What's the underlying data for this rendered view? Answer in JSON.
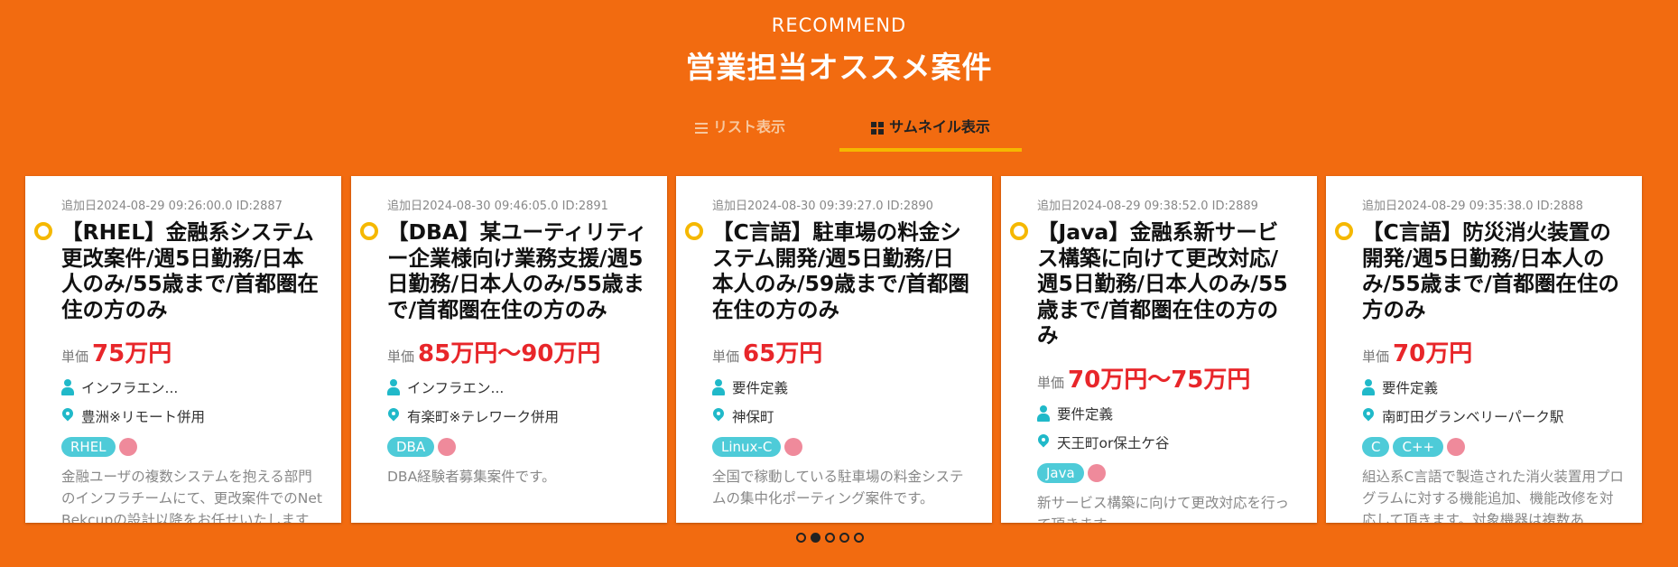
{
  "section": {
    "en": "RECOMMEND",
    "title": "営業担当オススメ案件"
  },
  "tabs": {
    "list": "リスト表示",
    "thumbnail": "サムネイル表示"
  },
  "cards": [
    {
      "date": "追加日2024-08-29 09:26:00.0 ID:2887",
      "title": "【RHEL】金融系システム更改案件/週5日勤務/日本人のみ/55歳まで/首都圏在住の方のみ",
      "price_label": "単価",
      "price": "75万円",
      "role": "インフラエン...",
      "location": "豊洲※リモート併用",
      "tags": [
        "RHEL"
      ],
      "desc": "金融ユーザの複数システムを抱える部門のインフラチームにて、更改案件でのNetBekcupの設計以降をお任せいたします"
    },
    {
      "date": "追加日2024-08-30 09:46:05.0 ID:2891",
      "title": "【DBA】某ユーティリティー企業様向け業務支援/週5日勤務/日本人のみ/55歳まで/首都圏在住の方のみ",
      "price_label": "単価",
      "price": "85万円～90万円",
      "role": "インフラエン...",
      "location": "有楽町※テレワーク併用",
      "tags": [
        "DBA"
      ],
      "desc": "DBA経験者募集案件です。"
    },
    {
      "date": "追加日2024-08-30 09:39:27.0 ID:2890",
      "title": "【C言語】駐車場の料金システム開発/週5日勤務/日本人のみ/59歳まで/首都圏在住の方のみ",
      "price_label": "単価",
      "price": "65万円",
      "role": "要件定義",
      "location": "神保町",
      "tags": [
        "Linux-C"
      ],
      "desc": "全国で稼動している駐車場の料金システムの集中化ポーティング案件です。"
    },
    {
      "date": "追加日2024-08-29 09:38:52.0 ID:2889",
      "title": "【Java】金融系新サービス構築に向けて更改対応/週5日勤務/日本人のみ/55歳まで/首都圏在住の方のみ",
      "price_label": "単価",
      "price": "70万円～75万円",
      "role": "要件定義",
      "location": "天王町or保土ケ谷",
      "tags": [
        "Java"
      ],
      "desc": "新サービス構築に向けて更改対応を行って頂きます"
    },
    {
      "date": "追加日2024-08-29 09:35:38.0 ID:2888",
      "title": "【C言語】防災消火装置の開発/週5日勤務/日本人のみ/55歳まで/首都圏在住の方のみ",
      "price_label": "単価",
      "price": "70万円",
      "role": "要件定義",
      "location": "南町田グランベリーパーク駅",
      "tags": [
        "C",
        "C++"
      ],
      "desc": "組込系C言語で製造された消火装置用プログラムに対する機能追加、機能改修を対応して頂きます。対象機器は複数あ"
    }
  ],
  "pagination": {
    "count": 5,
    "active": 1
  }
}
